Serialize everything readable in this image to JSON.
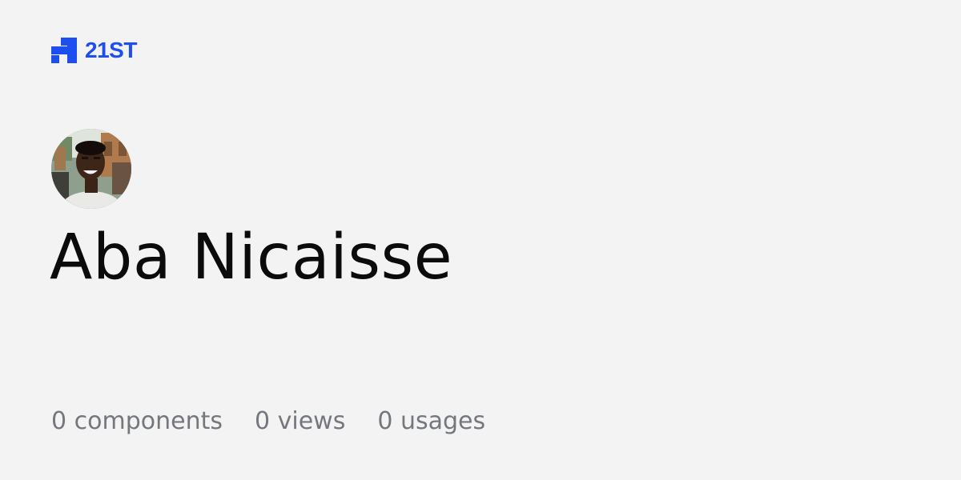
{
  "brand": {
    "name": "21ST",
    "color": "#1d4ff0",
    "icon": "21st-logo-icon"
  },
  "profile": {
    "name": "Aba Nicaisse",
    "avatar_icon": "user-avatar-photo"
  },
  "stats": {
    "components": "0 components",
    "views": "0 views",
    "usages": "0 usages"
  },
  "colors": {
    "background": "#f3f3f3",
    "title": "#0b0b0b",
    "stats": "#74777c"
  }
}
